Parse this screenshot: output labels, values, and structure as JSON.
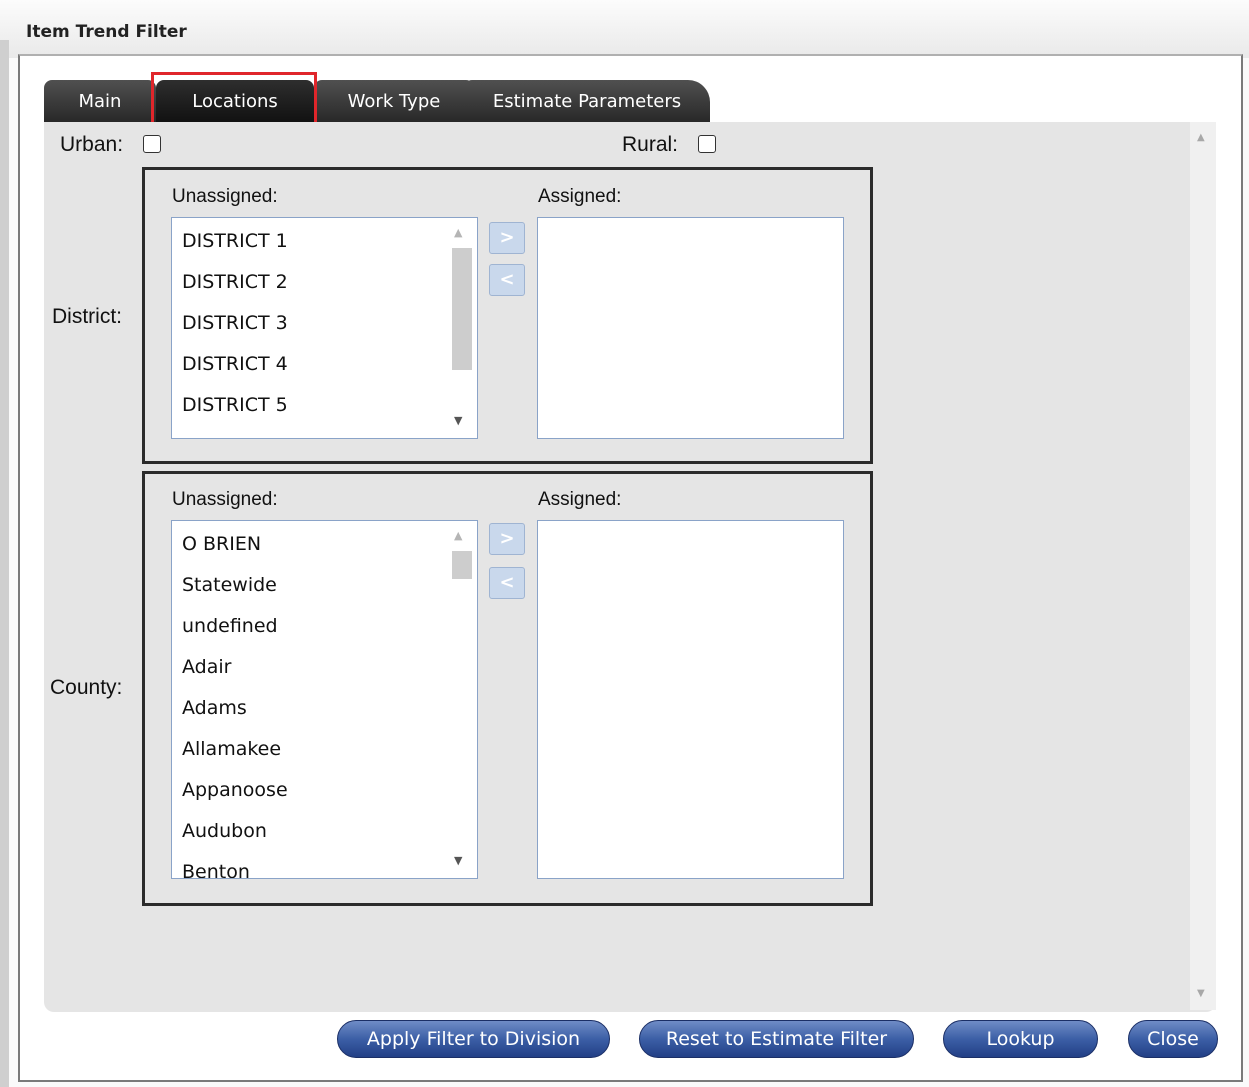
{
  "window": {
    "title": "Item Trend Filter"
  },
  "tabs": [
    {
      "label": "Main"
    },
    {
      "label": "Locations"
    },
    {
      "label": "Work Type"
    },
    {
      "label": "Estimate Parameters"
    }
  ],
  "urban": {
    "label": "Urban:"
  },
  "rural": {
    "label": "Rural:"
  },
  "district": {
    "label": "District:",
    "unassigned_label": "Unassigned:",
    "assigned_label": "Assigned:",
    "unassigned_items": [
      "DISTRICT 1",
      "DISTRICT 2",
      "DISTRICT 3",
      "DISTRICT 4",
      "DISTRICT 5"
    ],
    "move_right": ">",
    "move_left": "<"
  },
  "county": {
    "label": "County:",
    "unassigned_label": "Unassigned:",
    "assigned_label": "Assigned:",
    "unassigned_items": [
      "O BRIEN",
      "Statewide",
      "undefined",
      "Adair",
      "Adams",
      "Allamakee",
      "Appanoose",
      "Audubon",
      "Benton"
    ],
    "move_right": ">",
    "move_left": "<"
  },
  "buttons": {
    "apply": "Apply Filter to Division",
    "reset": "Reset to Estimate Filter",
    "lookup": "Lookup",
    "close": "Close"
  }
}
